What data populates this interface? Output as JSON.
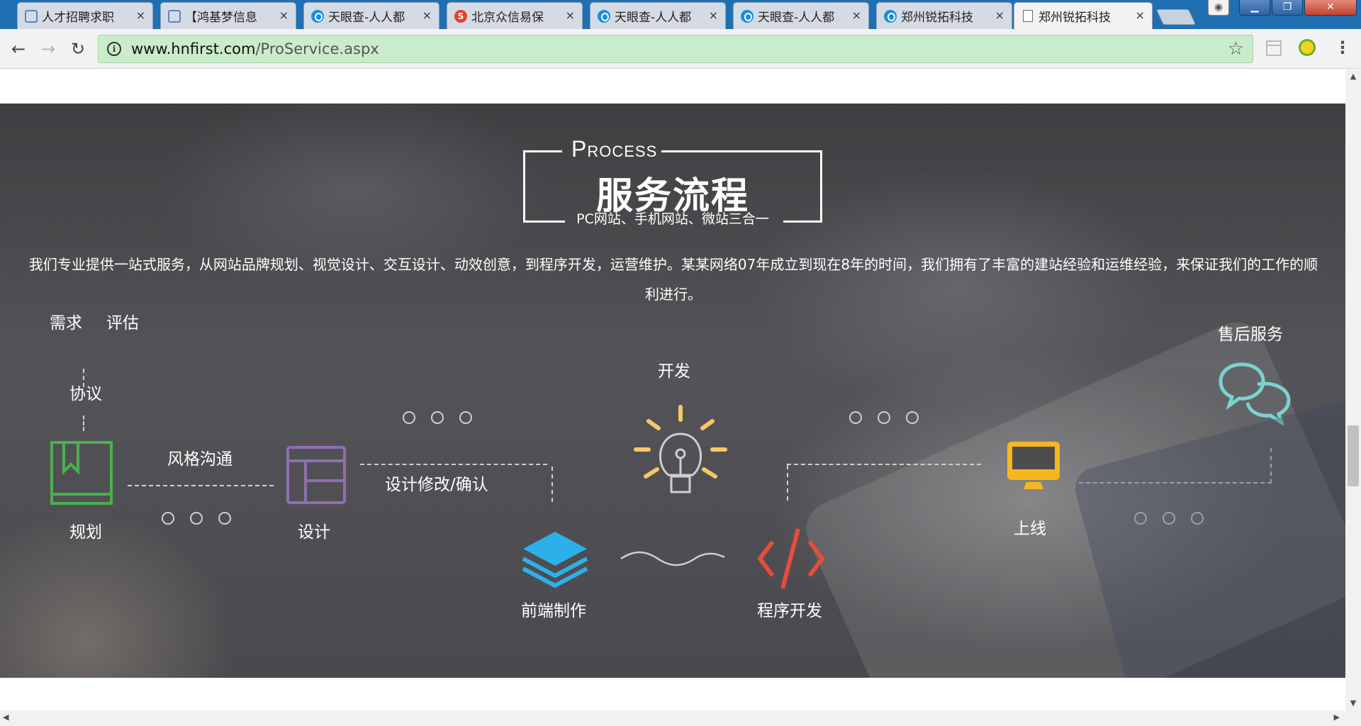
{
  "browser": {
    "tabs": [
      {
        "label": "人才招聘求职",
        "icon": "hand-icon",
        "active": false
      },
      {
        "label": "【鸿基梦信息",
        "icon": "hand-icon",
        "active": false
      },
      {
        "label": "天眼查-人人都",
        "icon": "tianyancha-icon",
        "active": false
      },
      {
        "label": "北京众信易保",
        "icon": "sogou-icon",
        "active": false
      },
      {
        "label": "天眼查-人人都",
        "icon": "tianyancha-icon",
        "active": false
      },
      {
        "label": "天眼查-人人都",
        "icon": "tianyancha-icon",
        "active": false
      },
      {
        "label": "郑州锐拓科技",
        "icon": "tianyancha-icon",
        "active": false
      },
      {
        "label": "郑州锐拓科技",
        "icon": "document-icon",
        "active": true
      }
    ],
    "tab_close_glyph": "×",
    "url_host": "www.hnfirst.com",
    "url_path": "/ProService.aspx",
    "nav": {
      "back": "←",
      "forward": "→",
      "reload": "↻"
    },
    "window": {
      "minimize": "▁",
      "restore": "❐",
      "close": "✕"
    },
    "accent_colors": {
      "omnibox_bg": "#c9eccb",
      "tabstrip_bg": "#1f6fb3"
    }
  },
  "page": {
    "title_en": "Process",
    "title_cn": "服务流程",
    "subtitle": "PC网站、手机网站、微站三合一",
    "intro": "我们专业提供一站式服务，从网站品牌规划、视觉设计、交互设计、动效创意，到程序开发，运营维护。某某网络07年成立到现在8年的时间，我们拥有了丰富的建站经验和运维经验，来保证我们的工作的顺利进行。",
    "steps": {
      "need": "需求",
      "evaluate": "评估",
      "agreement": "协议",
      "plan": "规划",
      "style": "风格沟通",
      "design": "设计",
      "revise": "设计修改/确认",
      "develop": "开发",
      "frontend": "前端制作",
      "program": "程序开发",
      "launch": "上线",
      "aftersales": "售后服务"
    },
    "icon_colors": {
      "plan": "#4caf50",
      "design": "#8e6fb0",
      "frontend": "#2db0e8",
      "develop": "#f7c766",
      "program": "#e74c3c",
      "launch": "#f5b71d",
      "aftersales": "#7ad3d0"
    }
  }
}
